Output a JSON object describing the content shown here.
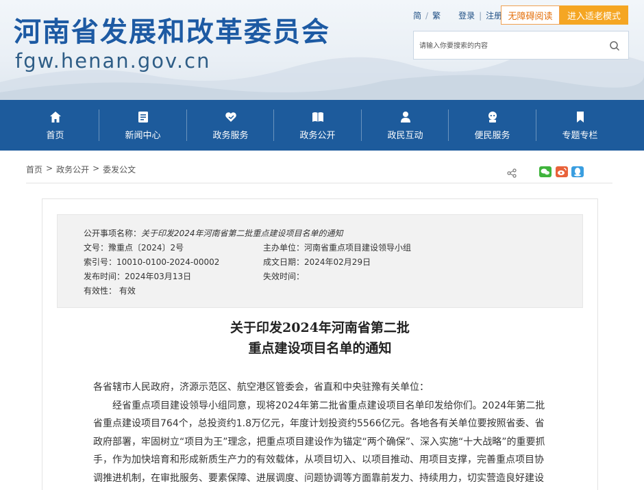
{
  "header": {
    "site_title": "河南省发展和改革委员会",
    "site_url": "fgw.henan.gov.cn",
    "lang_simple": "简",
    "lang_sep": "/",
    "lang_trad": "繁",
    "login": "登录",
    "register": "注册",
    "accessibility_btn": "无障碍阅读",
    "elder_btn": "进入适老模式",
    "search_placeholder": "请输入你要搜索的内容"
  },
  "nav": [
    {
      "label": "首页",
      "icon": "home-icon"
    },
    {
      "label": "新闻中心",
      "icon": "news-icon"
    },
    {
      "label": "政务服务",
      "icon": "heart-hand-icon"
    },
    {
      "label": "政务公开",
      "icon": "book-icon"
    },
    {
      "label": "政民互动",
      "icon": "people-icon"
    },
    {
      "label": "便民服务",
      "icon": "robot-icon"
    },
    {
      "label": "专题专栏",
      "icon": "bookmark-icon"
    }
  ],
  "breadcrumb": [
    "首页",
    ">",
    "政务公开",
    ">",
    "委发公文"
  ],
  "meta": {
    "subject_label": "公开事项名称：",
    "subject_value": "关于印发2024年河南省第二批重点建设项目名单的通知",
    "doc_no": "文号：豫重点〔2024〕2号",
    "host_unit": "主办单位：河南省重点项目建设领导小组",
    "index_no": "索引号：10010-0100-2024-00002",
    "created_date": "成文日期：2024年02月29日",
    "publish_date": "发布时间：2024年03月13日",
    "expire_date": "失效时间：",
    "validity": "有效性： 有效"
  },
  "document": {
    "title_line1": "关于印发2024年河南省第二批",
    "title_line2": "重点建设项目名单的通知",
    "salutation": "各省辖市人民政府，济源示范区、航空港区管委会，省直和中央驻豫有关单位：",
    "paragraph1": "经省重点项目建设领导小组同意，现将2024年第二批省重点建设项目名单印发给你们。2024年第二批省重点建设项目764个，总投资约1.8万亿元，年度计划投资约5566亿元。各地各有关单位要按照省委、省政府部署，牢固树立“项目为王”理念，把重点项目建设作为锚定“两个确保”、深入实施“十大战略”的重要抓手，作为加快培育和形成新质生产力的有效载体，从项目切入、以项目推动、用项目支撑，完善重点项目协调推进机制，在审批服务、要素保障、进展调度、问题协调等方面靠前发力、持续用力，切实营造良好建设环"
  },
  "colors": {
    "nav_bg": "#1d5b9c",
    "title_blue": "#1d5aa3",
    "elder_orange": "#f5a623"
  }
}
